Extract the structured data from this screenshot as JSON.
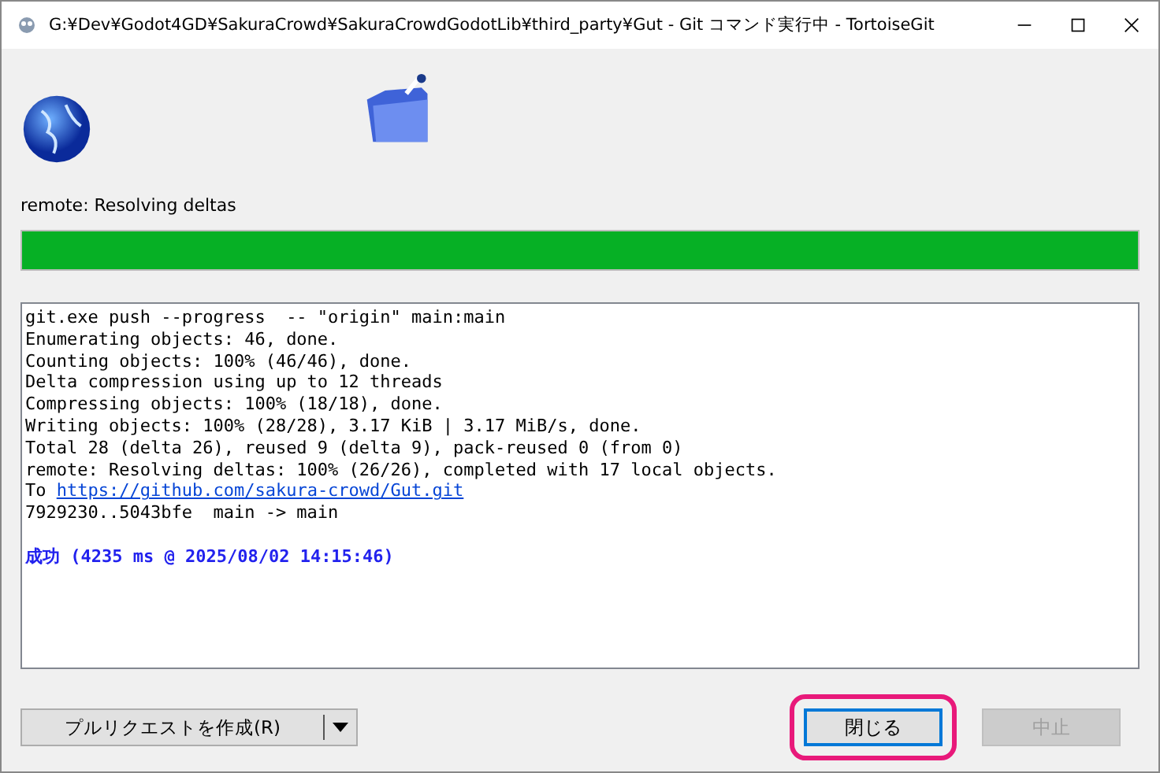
{
  "window": {
    "title": "G:¥Dev¥Godot4GD¥SakuraCrowd¥SakuraCrowdGodotLib¥third_party¥Gut - Git コマンド実行中 - TortoiseGit"
  },
  "status": {
    "text": "remote: Resolving deltas",
    "level": 1
  },
  "log": [
    {
      "kind": "plain",
      "text": "git.exe push --progress  -- \"origin\" main:main"
    },
    {
      "kind": "plain",
      "text": "Enumerating objects: 46, done."
    },
    {
      "kind": "plain",
      "text": "Counting objects: 100% (46/46), done."
    },
    {
      "kind": "plain",
      "text": "Delta compression using up to 12 threads"
    },
    {
      "kind": "plain",
      "text": "Compressing objects: 100% (18/18), done."
    },
    {
      "kind": "plain",
      "text": "Writing objects: 100% (28/28), 3.17 KiB | 3.17 MiB/s, done."
    },
    {
      "kind": "plain",
      "text": "Total 28 (delta 26), reused 9 (delta 9), pack-reused 0 (from 0)"
    },
    {
      "kind": "plain",
      "text": "remote: Resolving deltas: 100% (26/26), completed with 17 local objects."
    },
    {
      "kind": "link",
      "text": "To",
      "link": "https://github.com/sakura-crowd/Gut.git"
    },
    {
      "kind": "plain",
      "text": "7929230..5043bfe  main -> main"
    },
    {
      "kind": "blank"
    },
    {
      "kind": "success",
      "text": "成功 (4235 ms @ 2025/08/02 14:15:46)"
    }
  ],
  "buttons": {
    "pull_request": {
      "label": "プルリクエストを作成(R)"
    },
    "close": {
      "label": "閉じる",
      "highlighted": true,
      "focused": true,
      "disabled": false
    },
    "abort": {
      "label": "中止",
      "disabled": true
    }
  }
}
